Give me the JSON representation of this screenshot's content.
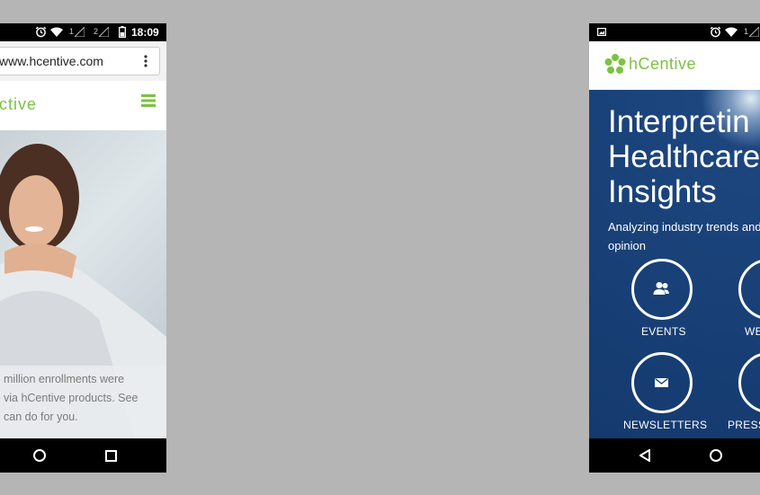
{
  "left_phone": {
    "status": {
      "sim1": "1",
      "sim2": "2",
      "time": "18:09"
    },
    "browser": {
      "url": "www.hcentive.com"
    },
    "header": {
      "logo_text": "ctive"
    },
    "hero": {
      "caption_lines": [
        "million enrollments were",
        "via hCentive products. See",
        "can do for you."
      ]
    }
  },
  "right_phone": {
    "header": {
      "logo_text": "hCentive"
    },
    "hero": {
      "title_lines": [
        "Interpretin",
        "Healthcare",
        "Insights"
      ],
      "subtitle_lines": [
        "Analyzing industry trends and",
        "opinion"
      ]
    },
    "buttons": [
      {
        "label": "EVENTS",
        "icon": "users-icon"
      },
      {
        "label": "WE",
        "icon": "webinar-icon"
      },
      {
        "label": "NEWSLETTERS",
        "icon": "envelope-icon"
      },
      {
        "label": "PRESS",
        "icon": "press-icon"
      }
    ]
  },
  "colors": {
    "brand_green": "#7cc242",
    "hero_blue": "#1d467f",
    "background": "#b5b5b5"
  }
}
